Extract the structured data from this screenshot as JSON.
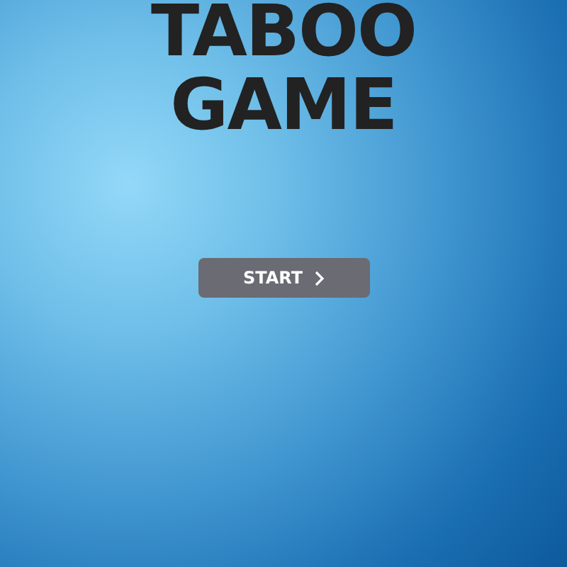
{
  "title": "TABOO GAME",
  "start_button": {
    "label": "START"
  }
}
